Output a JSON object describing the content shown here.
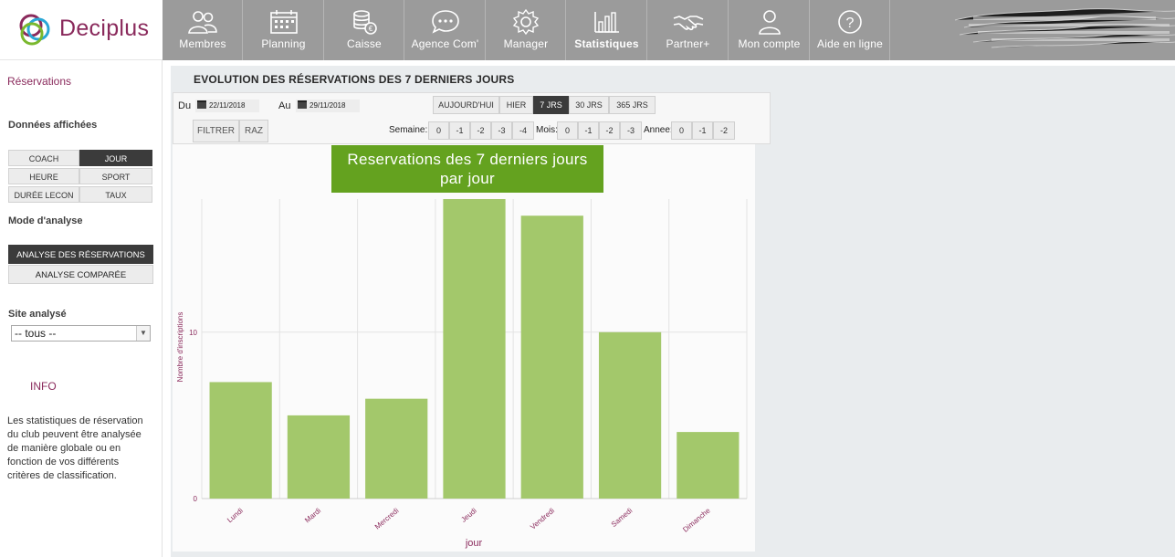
{
  "brand": {
    "name": "Deciplus"
  },
  "nav": [
    {
      "label": "Membres",
      "icon": "members-icon"
    },
    {
      "label": "Planning",
      "icon": "calendar-icon"
    },
    {
      "label": "Caisse",
      "icon": "coins-icon"
    },
    {
      "label": "Agence Com'",
      "icon": "chat-bubble-icon"
    },
    {
      "label": "Manager",
      "icon": "gear-icon"
    },
    {
      "label": "Statistiques",
      "icon": "bar-chart-icon",
      "active": true
    },
    {
      "label": "Partner+",
      "icon": "handshake-icon"
    },
    {
      "label": "Mon compte",
      "icon": "user-icon"
    },
    {
      "label": "Aide en ligne",
      "icon": "help-icon"
    }
  ],
  "sidebar": {
    "link": "Réservations",
    "data_heading": "Données affichées",
    "data_buttons": [
      "COACH",
      "JOUR",
      "HEURE",
      "SPORT",
      "DURÉE LECON",
      "TAUX"
    ],
    "data_active": "JOUR",
    "mode_heading": "Mode d'analyse",
    "mode_buttons": [
      "ANALYSE DES RÉSERVATIONS",
      "ANALYSE COMPARÉE"
    ],
    "mode_active": "ANALYSE DES RÉSERVATIONS",
    "site_heading": "Site analysé",
    "site_value": "-- tous --",
    "info_title": "INFO",
    "info_text": "Les statistiques de réservation du club peuvent être analysée de manière globale ou en fonction de vos différents critères de classification."
  },
  "main": {
    "title": "EVOLUTION DES RÉSERVATIONS DES 7 DERNIERS JOURS",
    "filters": {
      "from_label": "Du",
      "from_value": "22/11/2018",
      "to_label": "Au",
      "to_value": "29/11/2018",
      "quick": [
        "AUJOURD'HUI",
        "HIER",
        "7 JRS",
        "30 JRS",
        "365 JRS"
      ],
      "quick_active": "7 JRS",
      "filter_label": "FILTRER",
      "reset_label": "RAZ",
      "week_label": "Semaine:",
      "week_buttons": [
        "0",
        "-1",
        "-2",
        "-3",
        "-4"
      ],
      "month_label": "Mois:",
      "month_buttons": [
        "0",
        "-1",
        "-2",
        "-3"
      ],
      "year_label": "Annee:",
      "year_buttons": [
        "0",
        "-1",
        "-2"
      ]
    }
  },
  "chart_data": {
    "type": "bar",
    "title_line1": "Reservations des 7 derniers jours",
    "title_line2": "par jour",
    "xlabel": "jour",
    "ylabel": "Nombre d'inscriptions",
    "categories": [
      "Lundi",
      "Mardi",
      "Mercredi",
      "Jeudi",
      "Vendredi",
      "Samedi",
      "Dimanche"
    ],
    "values": [
      7,
      5,
      6,
      18,
      17,
      10,
      4
    ],
    "ylim": [
      0,
      18
    ],
    "yticks": [
      0,
      10
    ],
    "grid": true,
    "bar_color": "#a3c86b",
    "title_bg": "#64a21f"
  }
}
